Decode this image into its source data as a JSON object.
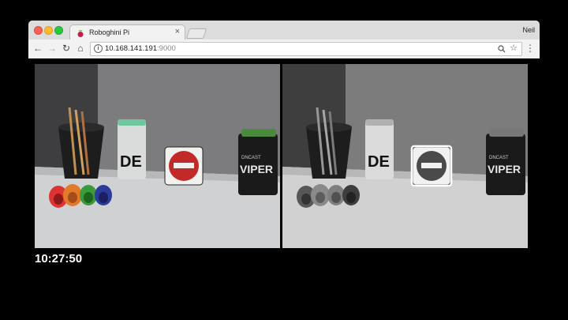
{
  "browser": {
    "tab": {
      "title": "Roboghini Pi",
      "close_glyph": "×",
      "favicon": "raspberry-icon"
    },
    "profile_name": "Neil",
    "address": {
      "host": "10.168.141.191",
      "port": ":9000"
    },
    "icons": [
      "back-arrow-icon",
      "forward-arrow-icon",
      "reload-icon",
      "home-icon",
      "info-icon",
      "zoom-icon",
      "star-icon",
      "menu-icon"
    ]
  },
  "camera": {
    "color_feed": {
      "label": "color-camera-feed"
    },
    "processed_feed": {
      "label": "grayscale-feed-with-detection",
      "detection_box_color": "#ffffff"
    },
    "sign_text_top": "DE",
    "can_text": "VIPER",
    "can_text_small": "DNCAST"
  },
  "clock": "10:27:50"
}
